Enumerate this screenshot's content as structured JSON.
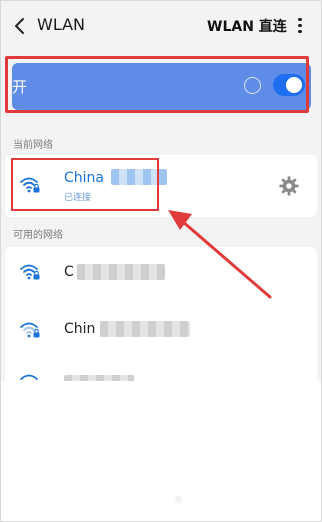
{
  "header": {
    "back_icon": "chevron-left-icon",
    "title": "WLAN",
    "direct_label": "WLAN 直连",
    "more_icon": "vertical-dots-icon"
  },
  "toggle": {
    "label": "开",
    "state": "on",
    "spinner_icon": "loading-spinner-icon"
  },
  "sections": {
    "current_title": "当前网络",
    "available_title": "可用的网络"
  },
  "current_network": {
    "ssid_prefix": "China",
    "status": "已连接",
    "wifi_icon": "wifi-lock-icon",
    "settings_icon": "gear-icon"
  },
  "available_networks": [
    {
      "ssid_prefix": "C",
      "wifi_icon": "wifi-lock-icon"
    },
    {
      "ssid_prefix": "Chin",
      "wifi_icon": "wifi-lock-icon"
    },
    {
      "ssid_prefix": "",
      "wifi_icon": "wifi-lock-icon"
    }
  ],
  "colors": {
    "accent_blue": "#1a73d9",
    "toggle_panel": "#5e8ce6",
    "annotation_red": "#e03a3a"
  }
}
